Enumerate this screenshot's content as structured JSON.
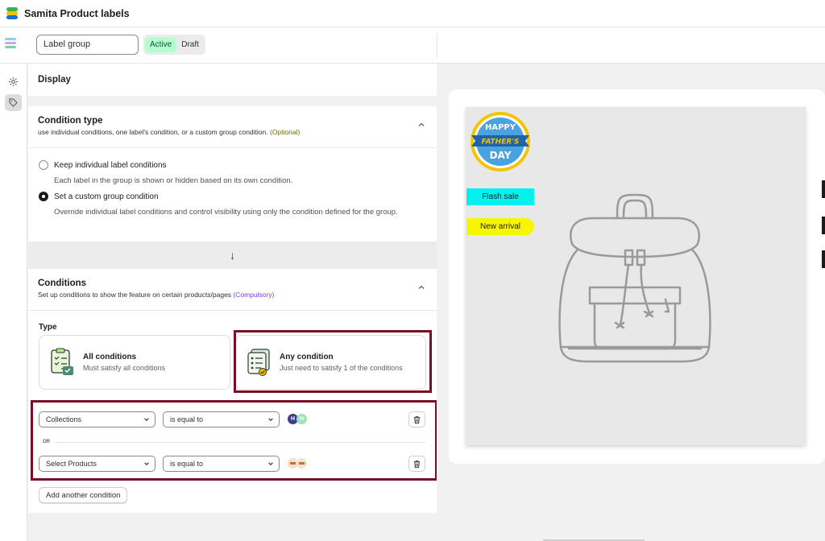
{
  "app": {
    "title": "Samita Product labels"
  },
  "toolbar": {
    "name_value": "Label group",
    "status_options": [
      "Active",
      "Draft"
    ],
    "status_selected": "Active"
  },
  "rail": {
    "items": [
      "settings-icon",
      "tag-icon"
    ],
    "selected": "tag-icon"
  },
  "display": {
    "heading": "Display"
  },
  "condition_type": {
    "title": "Condition type",
    "description": "use individual conditions, one label's condition, or a custom group condition.",
    "tag": "(Optional)",
    "options": [
      {
        "label": "Keep individual label conditions",
        "help": "Each label in the group is shown or hidden based on its own condition.",
        "selected": false
      },
      {
        "label": "Set a custom group condition",
        "help": "Override individual label conditions and control visibility using only the condition defined for the group.",
        "selected": true
      }
    ]
  },
  "arrow": "↓",
  "conditions": {
    "title": "Conditions",
    "description": "Set up conditions to show the feature on certain products/pages",
    "tag": "(Compulsory)",
    "type_label": "Type",
    "types": [
      {
        "title": "All conditions",
        "desc": "Must satisfy all conditions",
        "selected": false
      },
      {
        "title": "Any condition",
        "desc": "Just need to satisfy 1 of the conditions",
        "selected": true
      }
    ],
    "rules": [
      {
        "field": "Collections",
        "operator": "is equal to"
      },
      {
        "field": "Select Products",
        "operator": "is equal to"
      }
    ],
    "separator": "OR",
    "add_label": "Add another condition"
  },
  "preview": {
    "badges": {
      "circle_lines": [
        "HAPPY",
        "FATHER'S",
        "DAY"
      ],
      "flash": "Flash sale",
      "arrival": "New arrival"
    },
    "colors": {
      "flash_bg": "#00f2ee",
      "arrival_bg": "#f7f500",
      "highlight": "#7a0e24"
    }
  }
}
